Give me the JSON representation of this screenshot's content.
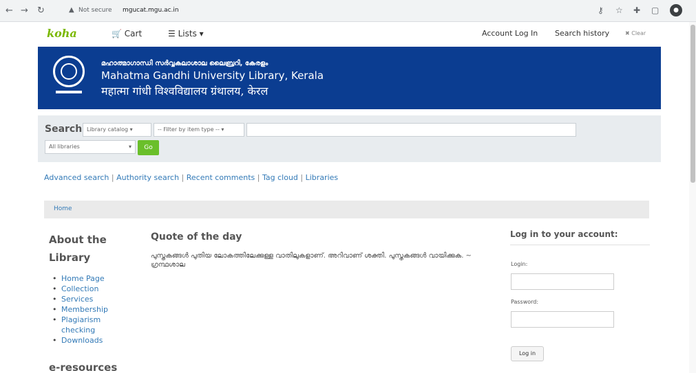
{
  "browser": {
    "back": "←",
    "forward": "→",
    "reload": "↻",
    "security_label": "Not secure",
    "url": "mgucat.mgu.ac.in"
  },
  "topbar": {
    "logo": "koha",
    "cart": "Cart",
    "lists": "Lists",
    "account_login": "Account Log In",
    "search_history": "Search history",
    "clear": "Clear"
  },
  "banner": {
    "line1": "മഹാത്മാഗാന്ധി സർവ്വകലാശാല ലൈബ്രറി, കേരളം",
    "line2": "Mahatma Gandhi University Library, Kerala",
    "line3": "महात्मा गांधी विश्वविद्यालय ग्रंथालय, केरल"
  },
  "search": {
    "label": "Search",
    "scope": "Library catalog",
    "item_type": "-- Filter by item type --",
    "library": "All libraries",
    "go": "Go"
  },
  "more_searches": {
    "advanced": "Advanced search",
    "authority": "Authority search",
    "recent_comments": "Recent comments",
    "tag_cloud": "Tag cloud",
    "libraries": "Libraries",
    "separator": "|"
  },
  "breadcrumb": {
    "home": "Home"
  },
  "sidebar": {
    "heading": "About the Library",
    "items": [
      {
        "label": "Home Page"
      },
      {
        "label": "Collection"
      },
      {
        "label": "Services"
      },
      {
        "label": "Membership"
      },
      {
        "label": "Plagiarism checking"
      },
      {
        "label": "Downloads"
      }
    ],
    "eresources_heading": "e-resources"
  },
  "quote": {
    "heading": "Quote of the day",
    "text": "പുസ്തകങ്ങൾ പുതിയ ലോകത്തിലേക്കുള്ള വാതിലുകളാണ്. അറിവാണ് ശക്തി. പുസ്തകങ്ങൾ വായിക്കുക. ~ ഗ്രന്ഥശാല"
  },
  "login": {
    "heading": "Log in to your account:",
    "login_label": "Login:",
    "password_label": "Password:",
    "button": "Log in"
  }
}
